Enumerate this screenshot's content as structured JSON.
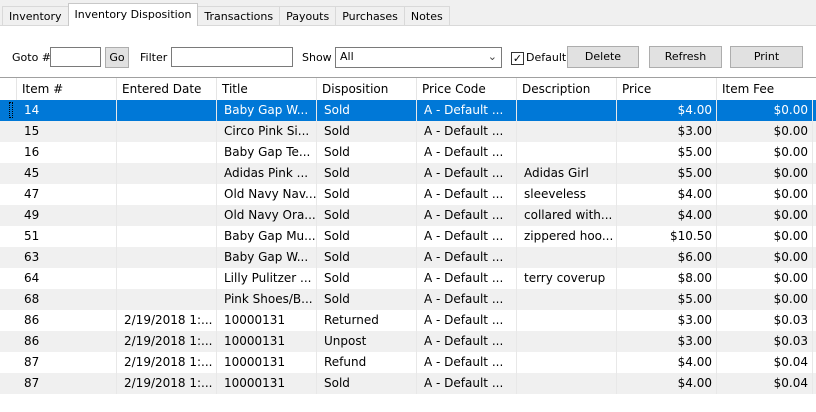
{
  "tabs": [
    "Inventory",
    "Inventory Disposition",
    "Transactions",
    "Payouts",
    "Purchases",
    "Notes"
  ],
  "toolbar": {
    "goto_label": "Goto #",
    "goto_value": "",
    "go_button": "Go",
    "filter_label": "Filter",
    "filter_value": "",
    "show_label": "Show",
    "show_value": "All",
    "default_checked": true,
    "default_label": "Default",
    "delete_button": "Delete",
    "refresh_button": "Refresh",
    "print_button": "Print"
  },
  "table": {
    "columns": [
      "Item #",
      "Entered Date",
      "Title",
      "Disposition",
      "Price Code",
      "Description",
      "Price",
      "Item Fee"
    ],
    "selected_row": 0,
    "rows": [
      [
        "14",
        "",
        "Baby Gap W...",
        "Sold",
        "A - Default ...",
        "",
        "$4.00",
        "$0.00"
      ],
      [
        "15",
        "",
        "Circo Pink Si...",
        "Sold",
        "A - Default ...",
        "",
        "$3.00",
        "$0.00"
      ],
      [
        "16",
        "",
        "Baby Gap Te...",
        "Sold",
        "A - Default ...",
        "",
        "$5.00",
        "$0.00"
      ],
      [
        "45",
        "",
        "Adidas Pink ...",
        "Sold",
        "A - Default ...",
        "Adidas Girl",
        "$5.00",
        "$0.00"
      ],
      [
        "47",
        "",
        "Old Navy Nav...",
        "Sold",
        "A - Default ...",
        "sleeveless",
        "$4.00",
        "$0.00"
      ],
      [
        "49",
        "",
        "Old Navy Ora...",
        "Sold",
        "A - Default ...",
        "collared with...",
        "$4.00",
        "$0.00"
      ],
      [
        "51",
        "",
        "Baby Gap Mu...",
        "Sold",
        "A - Default ...",
        "zippered hoo...",
        "$10.50",
        "$0.00"
      ],
      [
        "63",
        "",
        "Baby Gap W...",
        "Sold",
        "A - Default ...",
        "",
        "$6.00",
        "$0.00"
      ],
      [
        "64",
        "",
        "Lilly Pulitzer ...",
        "Sold",
        "A - Default ...",
        "terry coverup",
        "$8.00",
        "$0.00"
      ],
      [
        "68",
        "",
        "Pink Shoes/B...",
        "Sold",
        "A - Default ...",
        "",
        "$5.00",
        "$0.00"
      ],
      [
        "86",
        "2/19/2018 1:...",
        "10000131",
        "Returned",
        "A - Default ...",
        "",
        "$3.00",
        "$0.03"
      ],
      [
        "86",
        "2/19/2018 1:...",
        "10000131",
        "Unpost",
        "A - Default ...",
        "",
        "$3.00",
        "$0.03"
      ],
      [
        "87",
        "2/19/2018 1:...",
        "10000131",
        "Refund",
        "A - Default ...",
        "",
        "$4.00",
        "$0.04"
      ],
      [
        "87",
        "2/19/2018 1:...",
        "10000131",
        "Sold",
        "A - Default ...",
        "",
        "$4.00",
        "$0.04"
      ]
    ]
  }
}
